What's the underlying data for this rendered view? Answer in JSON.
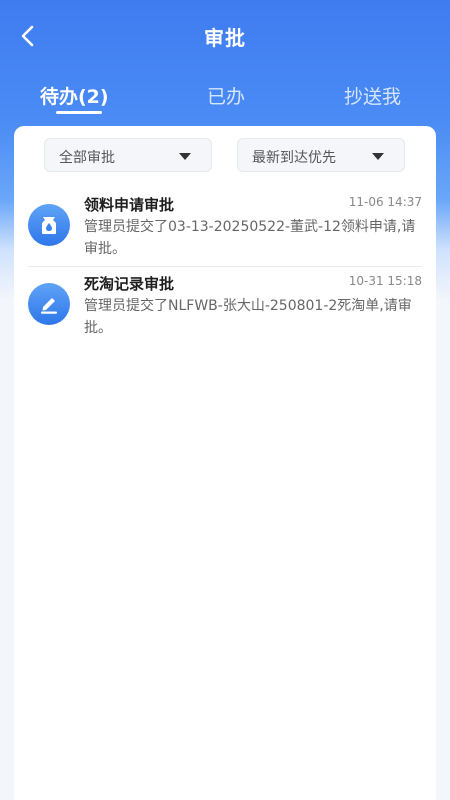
{
  "header": {
    "title": "审批",
    "back_icon": "chevron-left-icon"
  },
  "tabs": [
    {
      "label": "待办(2)",
      "active": true
    },
    {
      "label": "已办",
      "active": false
    },
    {
      "label": "抄送我",
      "active": false
    }
  ],
  "filters": {
    "type": {
      "selected": "全部审批"
    },
    "sort": {
      "selected": "最新到达优先"
    }
  },
  "approvals": [
    {
      "title": "领料申请审批",
      "time": "11-06 14:37",
      "description": "管理员提交了03-13-20250522-董武-12领料申请,请审批。",
      "icon": "material-bag-icon"
    },
    {
      "title": "死淘记录审批",
      "time": "10-31 15:18",
      "description": "管理员提交了NLFWB-张大山-250801-2死淘单,请审批。",
      "icon": "edit-pen-icon"
    }
  ],
  "colors": {
    "brand_blue": "#3f7cf1",
    "avatar_blue": "#2f76ea"
  }
}
